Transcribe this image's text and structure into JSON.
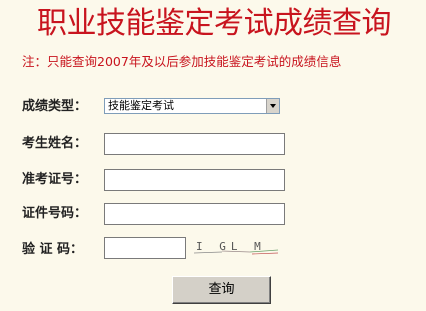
{
  "title": "职业技能鉴定考试成绩查询",
  "notice": "注：只能查询2007年及以后参加技能鉴定考试的成绩信息",
  "form": {
    "type_label": "成绩类型：",
    "type_value": "技能鉴定考试",
    "name_label": "考生姓名：",
    "ticket_label": "准考证号：",
    "id_label": "证件号码：",
    "captcha_label": "验 证 码：",
    "captcha_text": "I GL M",
    "submit_label": "查询"
  },
  "colors": {
    "title": "#c8141e",
    "background": "#fcf9eb"
  }
}
